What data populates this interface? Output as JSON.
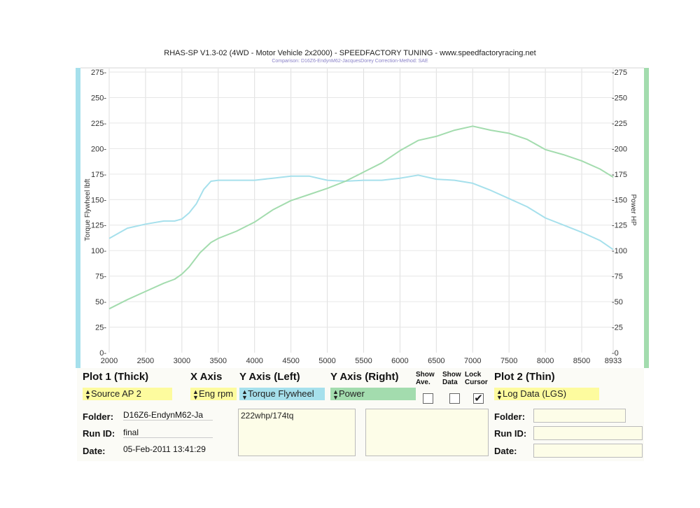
{
  "chart_data": {
    "type": "line",
    "title": "RHAS-SP V1.3-02  (4WD - Motor Vehicle 2x2000) - SPEEDFACTORY TUNING - www.speedfactoryracing.net",
    "subtitle": "Comparison: D16Z6-EndynM62-JacquesDorey      Correction-Method: SAE",
    "xlabel": "",
    "ylabel_left": "Torque Flywheel lbft",
    "ylabel_right": "Power HP",
    "xlim": [
      2000,
      8933
    ],
    "ylim": [
      0,
      275
    ],
    "x_ticks": [
      "2000",
      "2500",
      "3000",
      "3500",
      "4000",
      "4500",
      "5000",
      "5500",
      "6000",
      "6500",
      "7000",
      "7500",
      "8000",
      "8500",
      "8933"
    ],
    "y_ticks_left": [
      "0",
      "25",
      "50",
      "75",
      "100",
      "125",
      "150",
      "175",
      "200",
      "225",
      "250",
      "275"
    ],
    "y_ticks_right": [
      "-0",
      "-25",
      "-50",
      "-75",
      "-100",
      "-125",
      "-150",
      "-175",
      "-200",
      "-225",
      "-250",
      "-275"
    ],
    "grid": true,
    "colors": {
      "torque": "#a6e0ec",
      "power": "#a3dcae",
      "left_axis": "#a6e0ec",
      "right_axis": "#a3dcae"
    },
    "series": [
      {
        "name": "Torque Flywheel",
        "x": [
          2000,
          2250,
          2500,
          2750,
          2900,
          3000,
          3100,
          3200,
          3300,
          3400,
          3500,
          3750,
          4000,
          4250,
          4500,
          4750,
          5000,
          5250,
          5500,
          5750,
          6000,
          6250,
          6500,
          6750,
          7000,
          7250,
          7500,
          7750,
          8000,
          8250,
          8500,
          8750,
          8933
        ],
        "y": [
          112,
          122,
          126,
          129,
          129,
          131,
          137,
          146,
          160,
          168,
          169,
          169,
          169,
          171,
          173,
          173,
          169,
          168,
          169,
          169,
          171,
          174,
          170,
          169,
          166,
          159,
          151,
          143,
          132,
          125,
          118,
          110,
          101
        ]
      },
      {
        "name": "Power",
        "x": [
          2000,
          2250,
          2500,
          2750,
          2900,
          3000,
          3100,
          3250,
          3400,
          3500,
          3750,
          4000,
          4250,
          4500,
          4750,
          5000,
          5250,
          5500,
          5750,
          6000,
          6250,
          6500,
          6750,
          7000,
          7250,
          7500,
          7750,
          8000,
          8250,
          8500,
          8750,
          8933
        ],
        "y": [
          43,
          52,
          60,
          68,
          72,
          77,
          84,
          98,
          108,
          112,
          119,
          128,
          140,
          149,
          155,
          161,
          168,
          177,
          186,
          198,
          208,
          212,
          218,
          222,
          218,
          215,
          209,
          199,
          194,
          188,
          180,
          172
        ]
      }
    ]
  },
  "panel": {
    "plot1_header": "Plot 1 (Thick)",
    "x_axis_header": "X Axis",
    "y_axis_left_header": "Y Axis (Left)",
    "y_axis_right_header": "Y Axis (Right)",
    "show_ave_label": "Show Ave.",
    "show_data_label": "Show Data",
    "lock_cursor_label": "Lock Cursor",
    "plot2_header": "Plot 2 (Thin)",
    "source_value": "Source AP 2",
    "x_axis_value": "Eng rpm",
    "y_left_value": "Torque Flywheel",
    "y_right_value": "Power",
    "plot2_value": "Log Data (LGS)",
    "folder_label": "Folder:",
    "runid_label": "Run ID:",
    "date_label": "Date:",
    "folder_value": "D16Z6-EndynM62-Ja",
    "runid_value": "final",
    "date_value": "05-Feb-2011  13:41:29",
    "notes_value": "222whp/174tq",
    "colors": {
      "yellow": "#fdfb9e",
      "blue": "#a6e0ec",
      "green": "#a3dcae"
    }
  }
}
